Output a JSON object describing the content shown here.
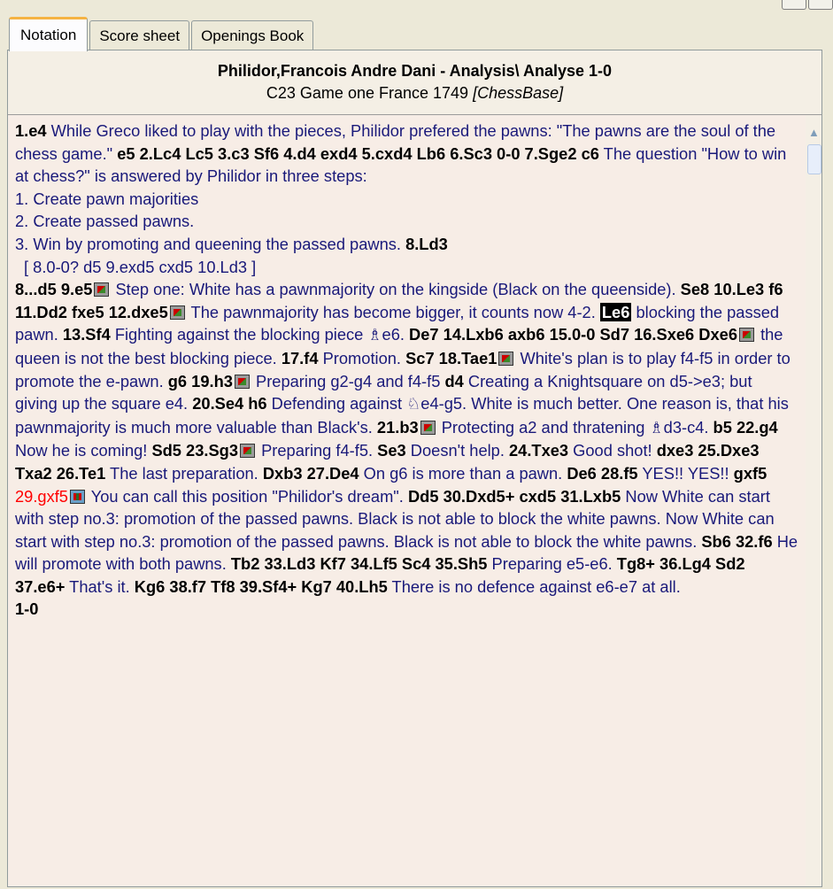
{
  "tabs": [
    "Notation",
    "Score sheet",
    "Openings Book"
  ],
  "header": {
    "title": "Philidor,Francois Andre Dani - Analysis\\ Analyse  1-0",
    "eco": "C23",
    "event": "Game one France 1749",
    "source": "[ChessBase]"
  },
  "notation": {
    "line1": [
      {
        "t": "m",
        "v": "1.e4"
      },
      {
        "t": "c",
        "v": " While Greco liked to play with the pieces, Philidor prefered the pawns: \"The pawns are the soul of the chess game.\" "
      },
      {
        "t": "m",
        "v": "e5  2.Lc4  Lc5  3.c3  Sf6  4.d4  exd4  5.cxd4  Lb6  6.Sc3  0-0  7.Sge2  c6"
      },
      {
        "t": "c",
        "v": " The question \"How to win at chess?\" is answered by Philidor in three steps:"
      }
    ],
    "steps": [
      "1. Create pawn majorities",
      "2. Create passed pawns.",
      "3. Win by promoting and queening the passed pawns. "
    ],
    "step3_move": "8.Ld3",
    "variation": "[ 8.0-0?  d5  9.exd5  cxd5  10.Ld3 ]",
    "main": [
      {
        "t": "m",
        "v": "8...d5  9.e5"
      },
      {
        "t": "i"
      },
      {
        "t": "c",
        "v": " Step one: White has a pawnmajority on the kingside (Black on the queenside).  "
      },
      {
        "t": "m",
        "v": "Se8  10.Le3  f6  11.Dd2  fxe5  12.dxe5"
      },
      {
        "t": "i"
      },
      {
        "t": "c",
        "v": " The pawnmajority has become bigger, it counts now 4-2.  "
      },
      {
        "t": "s",
        "v": "Le6"
      },
      {
        "t": "c",
        "v": " blocking the passed pawn.  "
      },
      {
        "t": "m",
        "v": "13.Sf4"
      },
      {
        "t": "c",
        "v": " Fighting against the blocking piece "
      },
      {
        "t": "p",
        "v": "♗"
      },
      {
        "t": "c",
        "v": "e6.  "
      },
      {
        "t": "m",
        "v": "De7  14.Lxb6  axb6  15.0-0  Sd7  16.Sxe6  Dxe6"
      },
      {
        "t": "i"
      },
      {
        "t": "c",
        "v": " the queen is not the best blocking piece.  "
      },
      {
        "t": "m",
        "v": "17.f4"
      },
      {
        "t": "c",
        "v": " Promotion.  "
      },
      {
        "t": "m",
        "v": "Sc7  18.Tae1"
      },
      {
        "t": "i"
      },
      {
        "t": "c",
        "v": " White's plan is to play f4-f5 in order to promote the e-pawn.  "
      },
      {
        "t": "m",
        "v": "g6  19.h3"
      },
      {
        "t": "i"
      },
      {
        "t": "c",
        "v": " Preparing g2-g4 and f4-f5  "
      },
      {
        "t": "m",
        "v": "d4"
      },
      {
        "t": "c",
        "v": " Creating a Knightsquare on d5->e3; but giving up the square e4.  "
      },
      {
        "t": "m",
        "v": "20.Se4  h6"
      },
      {
        "t": "c",
        "v": " Defending against "
      },
      {
        "t": "p",
        "v": "♘"
      },
      {
        "t": "c",
        "v": "e4-g5. White is much better. One reason is, that his pawnmajority is much more valuable than Black's.  "
      },
      {
        "t": "m",
        "v": "21.b3"
      },
      {
        "t": "i"
      },
      {
        "t": "c",
        "v": " Protecting a2 and thratening "
      },
      {
        "t": "p",
        "v": "♗"
      },
      {
        "t": "c",
        "v": "d3-c4.  "
      },
      {
        "t": "m",
        "v": "b5  22.g4"
      },
      {
        "t": "c",
        "v": " Now he is coming!  "
      },
      {
        "t": "m",
        "v": "Sd5  23.Sg3"
      },
      {
        "t": "i"
      },
      {
        "t": "c",
        "v": " Preparing f4-f5.  "
      },
      {
        "t": "m",
        "v": "Se3"
      },
      {
        "t": "c",
        "v": " Doesn't help.  "
      },
      {
        "t": "m",
        "v": "24.Txe3"
      },
      {
        "t": "c",
        "v": " Good shot!  "
      },
      {
        "t": "m",
        "v": "dxe3  25.Dxe3  Txa2  26.Te1"
      },
      {
        "t": "c",
        "v": " The last preparation.  "
      },
      {
        "t": "m",
        "v": "Dxb3  27.De4"
      },
      {
        "t": "c",
        "v": " On g6 is more than a pawn.  "
      },
      {
        "t": "m",
        "v": "De6  28.f5"
      },
      {
        "t": "c",
        "v": " YES!! YES!!  "
      },
      {
        "t": "m",
        "v": "gxf5"
      },
      {
        "t": "c",
        "v": "  "
      },
      {
        "t": "r",
        "v": "29.gxf5"
      },
      {
        "t": "i2"
      },
      {
        "t": "c",
        "v": " You can call this position \"Philidor's dream\".  "
      },
      {
        "t": "m",
        "v": "Dd5  30.Dxd5+  cxd5  31.Lxb5"
      },
      {
        "t": "c",
        "v": " Now White can start with step no.3: promotion of the passed pawns. Black is not able to block the white pawns. Now White can start with step no.3: promotion of the passed pawns. Black is not able to block the white pawns.  "
      },
      {
        "t": "m",
        "v": "Sb6  32.f6"
      },
      {
        "t": "c",
        "v": " He will promote with both pawns.  "
      },
      {
        "t": "m",
        "v": "Tb2  33.Ld3  Kf7  34.Lf5  Sc4  35.Sh5"
      },
      {
        "t": "c",
        "v": " Preparing e5-e6.  "
      },
      {
        "t": "m",
        "v": "Tg8+  36.Lg4  Sd2  37.e6+"
      },
      {
        "t": "c",
        "v": " That's it.  "
      },
      {
        "t": "m",
        "v": "Kg6  38.f7  Tf8  39.Sf4+  Kg7  40.Lh5"
      },
      {
        "t": "c",
        "v": " There is no defence against e6-e7 at all."
      }
    ],
    "result": "1-0"
  }
}
